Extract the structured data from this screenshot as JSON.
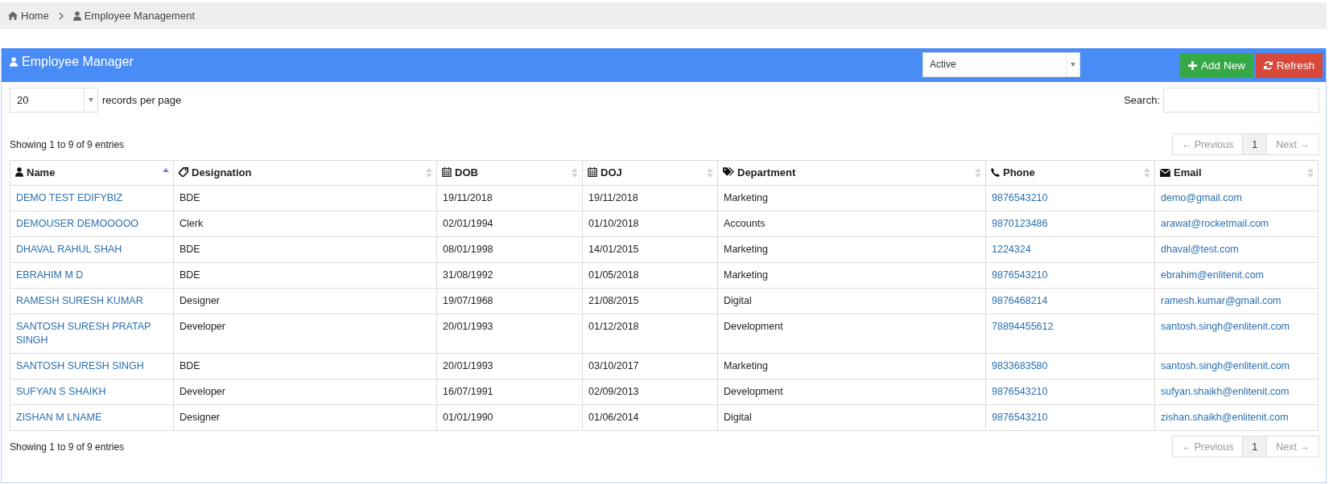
{
  "breadcrumb": [
    {
      "label": "Home"
    },
    {
      "label": "Employee Management"
    }
  ],
  "panel": {
    "title": "Employee Manager",
    "status_filter": {
      "value": "Active"
    },
    "buttons": [
      {
        "label": "Add New",
        "kind": "add"
      },
      {
        "label": "Refresh",
        "kind": "refresh"
      }
    ]
  },
  "length_select": {
    "value": "20",
    "label": "records per page"
  },
  "search": {
    "label": "Search:"
  },
  "info_top": "Showing 1 to 9 of 9 entries",
  "info_bottom": "Showing 1 to 9 of 9 entries",
  "pagination_top": [
    {
      "label": "← Previous",
      "disabled": true,
      "selected": false
    },
    {
      "label": "1",
      "disabled": false,
      "selected": true
    },
    {
      "label": "Next →",
      "disabled": true,
      "selected": false
    }
  ],
  "pagination_bottom": [
    {
      "label": "← Previous",
      "disabled": true,
      "selected": false
    },
    {
      "label": "1",
      "disabled": false,
      "selected": true
    },
    {
      "label": "Next →",
      "disabled": true,
      "selected": false
    }
  ],
  "table": {
    "columns": [
      {
        "label": "Name",
        "sorted": true
      },
      {
        "label": "Designation",
        "sorted": false
      },
      {
        "label": "DOB",
        "sorted": false
      },
      {
        "label": "DOJ",
        "sorted": false
      },
      {
        "label": "Department",
        "sorted": false
      },
      {
        "label": "Phone",
        "sorted": false
      },
      {
        "label": "Email",
        "sorted": false
      }
    ],
    "rows": [
      [
        "DEMO TEST EDIFYBIZ",
        "BDE",
        "19/11/2018",
        "19/11/2018",
        "Marketing",
        "9876543210",
        "demo@gmail.com"
      ],
      [
        "DEMOUSER DEMOOOOO",
        "Clerk",
        "02/01/1994",
        "01/10/2018",
        "Accounts",
        "9870123486",
        "arawat@rocketmail.com"
      ],
      [
        "DHAVAL RAHUL SHAH",
        "BDE",
        "08/01/1998",
        "14/01/2015",
        "Marketing",
        "1224324",
        "dhaval@test.com"
      ],
      [
        "EBRAHIM M D",
        "BDE",
        "31/08/1992",
        "01/05/2018",
        "Marketing",
        "9876543210",
        "ebrahim@enlitenit.com"
      ],
      [
        "RAMESH SURESH KUMAR",
        "Designer",
        "19/07/1968",
        "21/08/2015",
        "Digital",
        "9876468214",
        "ramesh.kumar@gmail.com"
      ],
      [
        "SANTOSH SURESH PRATAP SINGH",
        "Developer",
        "20/01/1993",
        "01/12/2018",
        "Development",
        "78894455612",
        "santosh.singh@enlitenit.com"
      ],
      [
        "SANTOSH SURESH SINGH",
        "BDE",
        "20/01/1993",
        "03/10/2017",
        "Marketing",
        "9833683580",
        "santosh.singh@enlitenit.com"
      ],
      [
        "SUFYAN S SHAIKH",
        "Developer",
        "16/07/1991",
        "02/09/2013",
        "Development",
        "9876543210",
        "sufyan.shaikh@enlitenit.com"
      ],
      [
        "ZISHAN M LNAME",
        "Designer",
        "01/01/1990",
        "01/06/2014",
        "Digital",
        "9876543210",
        "zishan.shaikh@enlitenit.com"
      ]
    ]
  }
}
